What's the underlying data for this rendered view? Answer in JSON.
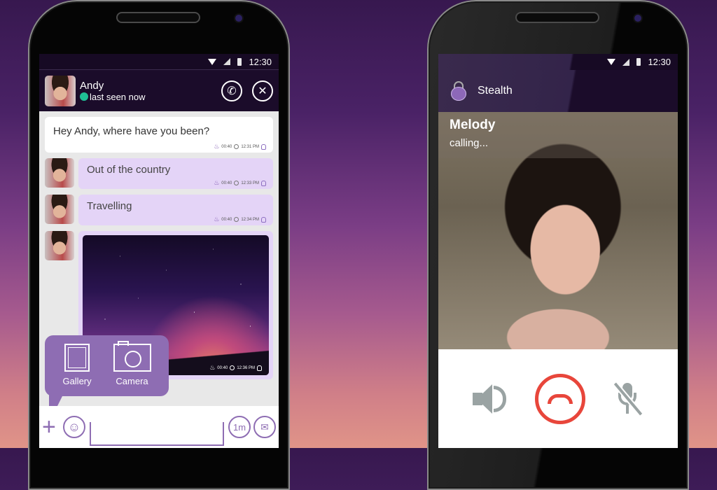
{
  "status_bar": {
    "time": "12:30"
  },
  "chat": {
    "contact": {
      "name": "Andy",
      "status": "last seen now"
    },
    "header_actions": {
      "call_icon": "phone-icon",
      "close_icon": "close-icon"
    },
    "messages": [
      {
        "direction": "outgoing",
        "text": "Hey Andy, where have you been?",
        "timer": "00:40",
        "time": "12:31 PM"
      },
      {
        "direction": "incoming",
        "text": "Out of the country",
        "timer": "00:40",
        "time": "12:33 PM"
      },
      {
        "direction": "incoming",
        "text": "Travelling",
        "timer": "00:40",
        "time": "12:34 PM"
      },
      {
        "direction": "incoming",
        "type": "image",
        "image": "night-sky-photo",
        "timer": "00:40",
        "time": "12:36 PM"
      }
    ],
    "attach_menu": [
      {
        "label": "Gallery",
        "icon": "gallery-icon"
      },
      {
        "label": "Camera",
        "icon": "camera-icon"
      }
    ],
    "composer": {
      "input_value": "",
      "timer_label": "1m"
    }
  },
  "call": {
    "app_title": "Stealth",
    "caller_name": "Melody",
    "state": "calling...",
    "controls": [
      "speaker-icon",
      "hang-up-icon",
      "mute-icon"
    ],
    "colors": {
      "hangup": "#e8463b",
      "control_gray": "#9aa3a3"
    }
  },
  "colors": {
    "accent": "#8e6db3",
    "online": "#1fbf95",
    "bubble_in": "#e4d4f7",
    "header_bg": "#1b0c2a"
  }
}
